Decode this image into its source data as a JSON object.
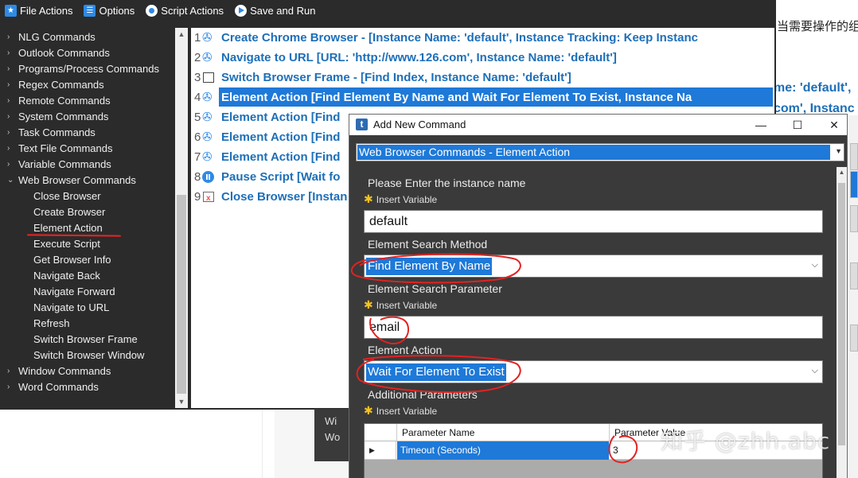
{
  "menubar": {
    "items": [
      {
        "label": "File Actions",
        "icon": "star-icon"
      },
      {
        "label": "Options",
        "icon": "list-icon"
      },
      {
        "label": "Script Actions",
        "icon": "record-icon"
      },
      {
        "label": "Save and Run",
        "icon": "play-icon"
      }
    ]
  },
  "tree": {
    "items": [
      {
        "label": "NLG Commands",
        "level": 0,
        "expanded": false
      },
      {
        "label": "Outlook Commands",
        "level": 0,
        "expanded": false
      },
      {
        "label": "Programs/Process Commands",
        "level": 0,
        "expanded": false
      },
      {
        "label": "Regex Commands",
        "level": 0,
        "expanded": false
      },
      {
        "label": "Remote Commands",
        "level": 0,
        "expanded": false
      },
      {
        "label": "System Commands",
        "level": 0,
        "expanded": false
      },
      {
        "label": "Task Commands",
        "level": 0,
        "expanded": false
      },
      {
        "label": "Text File Commands",
        "level": 0,
        "expanded": false
      },
      {
        "label": "Variable Commands",
        "level": 0,
        "expanded": false
      },
      {
        "label": "Web Browser Commands",
        "level": 0,
        "expanded": true
      },
      {
        "label": "Close Browser",
        "level": 1
      },
      {
        "label": "Create Browser",
        "level": 1
      },
      {
        "label": "Element Action",
        "level": 1
      },
      {
        "label": "Execute Script",
        "level": 1
      },
      {
        "label": "Get Browser Info",
        "level": 1
      },
      {
        "label": "Navigate Back",
        "level": 1
      },
      {
        "label": "Navigate Forward",
        "level": 1
      },
      {
        "label": "Navigate to URL",
        "level": 1
      },
      {
        "label": "Refresh",
        "level": 1
      },
      {
        "label": "Switch Browser Frame",
        "level": 1
      },
      {
        "label": "Switch Browser Window",
        "level": 1
      },
      {
        "label": "Window Commands",
        "level": 0,
        "expanded": false
      },
      {
        "label": "Word Commands",
        "level": 0,
        "expanded": false
      }
    ]
  },
  "script": {
    "rows": [
      {
        "num": "1",
        "icon": "web",
        "text": "Create Chrome Browser - [Instance Name: 'default', Instance Tracking: Keep Instanc"
      },
      {
        "num": "2",
        "icon": "web",
        "text": "Navigate to URL [URL: 'http://www.126.com', Instance Name: 'default']"
      },
      {
        "num": "3",
        "icon": "frame",
        "text": "Switch Browser Frame - [Find Index, Instance Name: 'default']"
      },
      {
        "num": "4",
        "icon": "web",
        "text": "Element Action [Find Element By Name and Wait For Element To Exist, Instance Na",
        "selected": true
      },
      {
        "num": "5",
        "icon": "web",
        "text": "Element Action [Find"
      },
      {
        "num": "6",
        "icon": "web",
        "text": "Element Action [Find"
      },
      {
        "num": "7",
        "icon": "web",
        "text": "Element Action [Find"
      },
      {
        "num": "8",
        "icon": "pause",
        "text": "Pause Script [Wait fo"
      },
      {
        "num": "9",
        "icon": "close",
        "text": "Close Browser [Instan"
      }
    ],
    "overflow_line_1": "me: 'default',",
    "overflow_line_2": "com', Instanc"
  },
  "background": {
    "article_text": "当需要操作的组",
    "dark_items": [
      "Wi",
      "Wo"
    ]
  },
  "dialog": {
    "title": "Add New Command",
    "logo_letter": "t",
    "minimize": "—",
    "maximize": "☐",
    "close": "✕",
    "command": "Web Browser Commands - Element Action",
    "instance_label": "Please Enter the instance name",
    "insert_variable": "Insert Variable",
    "instance_value": "default",
    "search_method_label": "Element Search Method",
    "search_method_value": "Find Element By Name",
    "search_param_label": "Element Search Parameter",
    "search_param_value": "email",
    "action_label": "Element Action",
    "action_value": "Wait For Element To Exist",
    "additional_label": "Additional Parameters",
    "grid": {
      "headers": [
        "Parameter Name",
        "Parameter Value"
      ],
      "rows": [
        {
          "name": "Timeout (Seconds)",
          "value": "3"
        }
      ]
    }
  },
  "watermark": "知乎 @zhh.abc",
  "colors": {
    "accent": "#1e79d8",
    "link": "#1d6fb8",
    "dark_bg": "#2b2b2b",
    "dialog_bg": "#3a3a3a",
    "annotation": "#e22222"
  }
}
